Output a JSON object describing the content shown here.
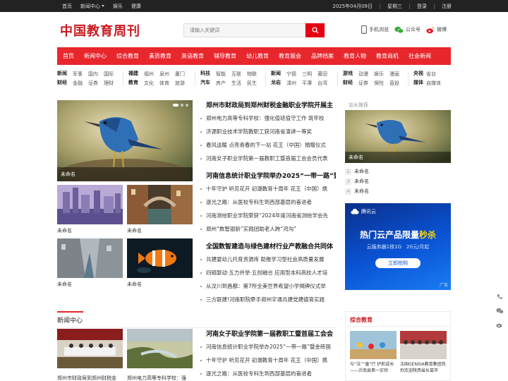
{
  "topbar": {
    "left": [
      "首页",
      "新闻中心",
      "娱乐",
      "健康"
    ],
    "date": "2025年04月09日",
    "weekday": "星期三",
    "login": "登录",
    "register": "注册"
  },
  "header": {
    "logo": "中国教育周刊",
    "search_placeholder": "请输入关键词",
    "links": [
      "手机浏览",
      "公众号",
      "微博"
    ]
  },
  "nav": [
    "首页",
    "新闻中心",
    "综合教育",
    "素质教育",
    "英语教育",
    "辅导教育",
    "幼儿教育",
    "教育展会",
    "品牌档案",
    "教育人物",
    "教育商机",
    "社会新闻"
  ],
  "subnav": [
    {
      "cols": 4,
      "rows": [
        [
          "新闻",
          "军事",
          "国内",
          "国际"
        ],
        [
          "财经",
          "金融",
          "证券",
          "理财"
        ]
      ]
    },
    {
      "cols": 4,
      "rows": [
        [
          "福建",
          "福州",
          "泉州",
          "厦门"
        ],
        [
          "教育",
          "文化",
          "体育",
          "旅游"
        ]
      ]
    },
    {
      "cols": 4,
      "rows": [
        [
          "科技",
          "智能",
          "互联",
          "物联"
        ],
        [
          "汽车",
          "房产",
          "生活",
          "民生"
        ]
      ]
    },
    {
      "cols": 4,
      "rows": [
        [
          "新闻",
          "宁德",
          "三明",
          "莆田"
        ],
        [
          "龙岩",
          "漳州",
          "平潭",
          "台湾"
        ]
      ]
    },
    {
      "cols": 4,
      "rows": [
        [
          "游戏",
          "动漫",
          "娱乐",
          "漫画"
        ],
        [
          "财经",
          "证券",
          "保险",
          "直投"
        ]
      ]
    },
    {
      "cols": 2,
      "rows": [
        [
          "央视",
          "省台"
        ],
        [
          "媒体",
          "自媒体"
        ]
      ]
    }
  ],
  "featured": {
    "caption": "未命名"
  },
  "thumbs": [
    "未命名",
    "未命名",
    "未命名",
    "未命名"
  ],
  "news_blocks": [
    {
      "head": "郑州市财政局到郑州财税金融职业学院开展主",
      "items": [
        "郑州电力高等专科学校：强化值班值守工作 筑牢校",
        "济源职业技术学院教职工获河南省演讲一等奖",
        "春风送暖 点亮青春的下一站 花王（中国）捐赠仪式",
        "河南女子职业学院第一届教职工暨首届工会会员代表"
      ]
    },
    {
      "head": "河南信息统计职业学院举办2025“一带一路”暨",
      "items": [
        "十年守护 听见花开 初潮教育十周年 花王（中国）携",
        "逐光之路：从医校专科生到西部基层的奋进者",
        "河南测绘职业学院荣获“2024年度河南省测绘学会先",
        "郑州“数智银龄”实践团助老人跨“鸿沟”"
      ]
    },
    {
      "head": "全国数智建造与绿色建材行业产教融合共同体",
      "items": [
        "共建婴幼儿托育资源库 助推学习型社会高质量发展",
        "四链联动·五力并举·五创融合 应用型本科高校人才培",
        "从汶川到昌都：第7所全美世界希望小学揭牌仪式举",
        "三方联建!河南职院牵手郑州宇通共建党建德育实践"
      ]
    },
    {
      "head": "河南女子职业学院第一届教职工暨首届工会会",
      "items": [
        "河南信息统计职业学院举办2025“一带一路”暨金砖国",
        "十年守护 听见花开 初潮教育十周年 花王（中国）携",
        "逐光之路：从医校专科生到西部基层的奋进者"
      ]
    }
  ],
  "right": {
    "title": "站长推荐",
    "img_caption": "未命名",
    "list": [
      {
        "n": "2",
        "t": "未命名"
      },
      {
        "n": "3",
        "t": "未命名"
      },
      {
        "n": "4",
        "t": "未命名"
      }
    ]
  },
  "ad": {
    "brand": "腾讯云",
    "headline_a": "热门云产品限量",
    "headline_b": "秒杀",
    "sub": "云服务器1核1G　20元/月起",
    "button": "立即抢购",
    "tag": "广告"
  },
  "section": {
    "title": "新闻中心"
  },
  "section_thumbs": [
    "郑州市财政局到郑州财税金",
    "郑州电力高等专科学校：强"
  ],
  "rbox": {
    "title": "综合教育",
    "items": [
      "与“法”“童”行 护航成长——沂南县第一实验",
      "法国GENSIA教育集团热烈欢迎陕西省长葛市"
    ]
  },
  "colors": {
    "accent": "#e8272d",
    "logo": "#c8191f",
    "topbar": "#222222"
  }
}
